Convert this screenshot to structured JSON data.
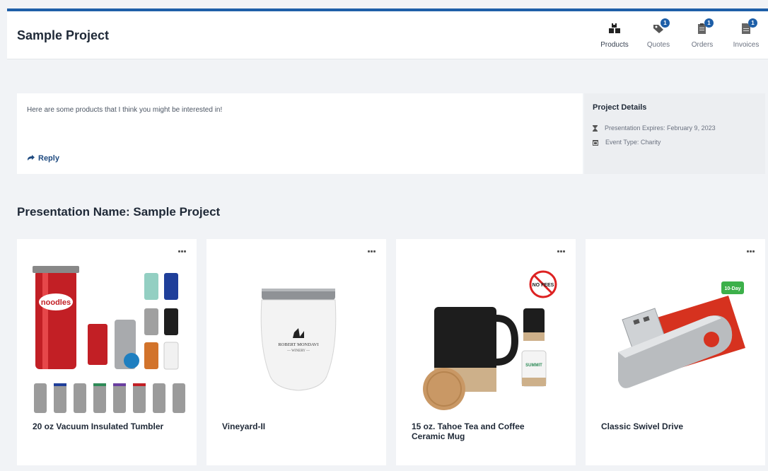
{
  "header": {
    "project_title": "Sample Project",
    "nav": [
      {
        "label": "Products",
        "icon": "boxes-icon",
        "badge": ""
      },
      {
        "label": "Quotes",
        "icon": "tag-icon",
        "badge": "1"
      },
      {
        "label": "Orders",
        "icon": "clipboard-icon",
        "badge": "1"
      },
      {
        "label": "Invoices",
        "icon": "invoice-icon",
        "badge": "1"
      }
    ]
  },
  "message": {
    "text": "Here are some products that I think you might be interested in!",
    "reply_label": "Reply"
  },
  "details": {
    "title": "Project Details",
    "expires": "Presentation Expires: February 9, 2023",
    "event_type": "Event Type: Charity"
  },
  "presentation": {
    "title": "Presentation Name: Sample Project"
  },
  "products": [
    {
      "name": "20 oz Vacuum Insulated Tumbler"
    },
    {
      "name": "Vineyard-II"
    },
    {
      "name": "15 oz. Tahoe Tea and Coffee Ceramic Mug"
    },
    {
      "name": "Classic Swivel Drive"
    }
  ],
  "image_text": {
    "tumbler_brand": "noodles",
    "winery_line1": "ROBERT MONDAVI",
    "winery_line2": "— WINERY —",
    "no_fees": "NO FEES",
    "mug_brand": "SUMMIT",
    "ten_day": "10-Day"
  },
  "colors": {
    "accent": "#1e5fa8",
    "reply": "#1e4a80",
    "background": "#f1f3f6"
  }
}
